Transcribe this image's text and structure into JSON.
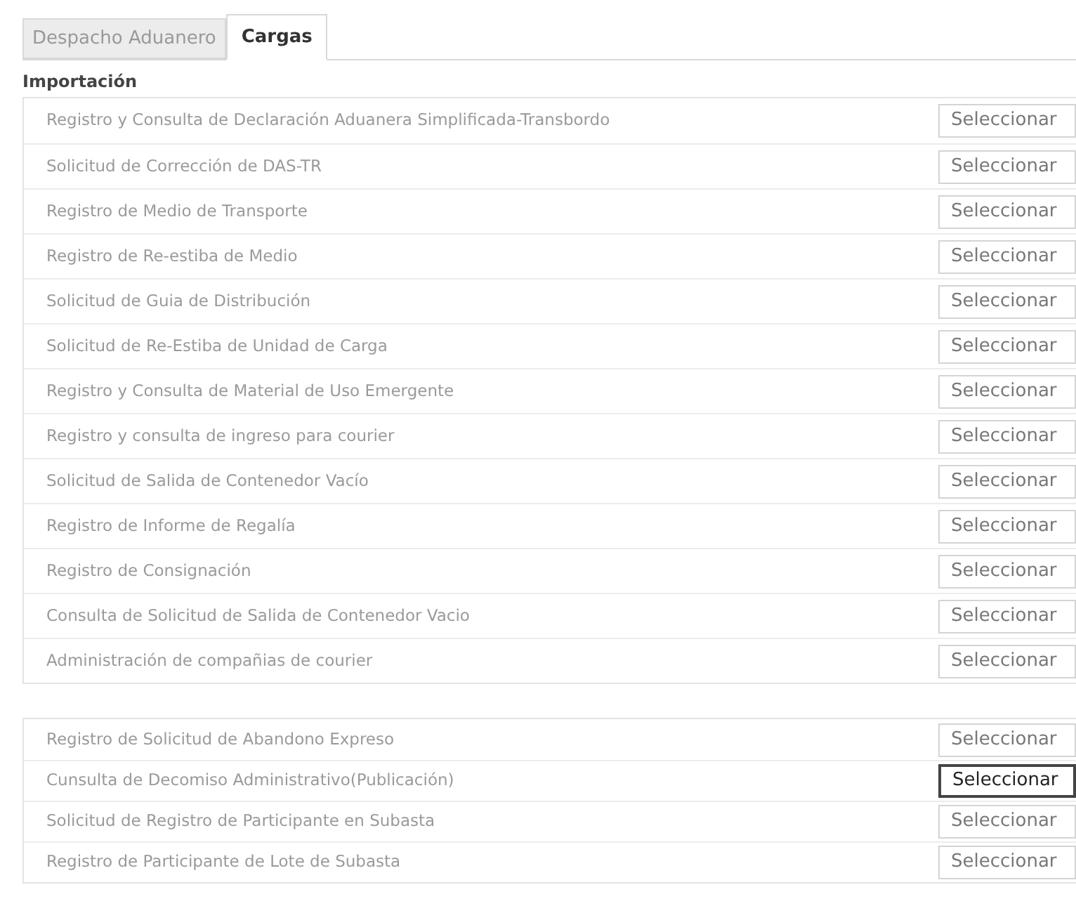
{
  "tabs": [
    {
      "label": "Despacho Aduanero",
      "selected": false
    },
    {
      "label": "Cargas",
      "selected": true
    }
  ],
  "section_title": "Importación",
  "groups": [
    {
      "items": [
        {
          "label": "Registro y Consulta de Declaración Aduanera Simplificada-Transbordo",
          "button": "Seleccionar",
          "focused": false
        },
        {
          "label": "Solicitud de Corrección de DAS-TR",
          "button": "Seleccionar",
          "focused": false
        },
        {
          "label": "Registro de Medio de Transporte",
          "button": "Seleccionar",
          "focused": false
        },
        {
          "label": "Registro de Re-estiba de Medio",
          "button": "Seleccionar",
          "focused": false
        },
        {
          "label": "Solicitud de Guia de Distribución",
          "button": "Seleccionar",
          "focused": false
        },
        {
          "label": "Solicitud de Re-Estiba de Unidad de Carga",
          "button": "Seleccionar",
          "focused": false
        },
        {
          "label": "Registro y Consulta de Material de Uso Emergente",
          "button": "Seleccionar",
          "focused": false
        },
        {
          "label": "Registro y consulta de ingreso para courier",
          "button": "Seleccionar",
          "focused": false
        },
        {
          "label": "Solicitud de Salida de Contenedor Vacío",
          "button": "Seleccionar",
          "focused": false
        },
        {
          "label": "Registro de Informe de Regalía",
          "button": "Seleccionar",
          "focused": false
        },
        {
          "label": "Registro de Consignación",
          "button": "Seleccionar",
          "focused": false
        },
        {
          "label": "Consulta de Solicitud de Salida de Contenedor Vacio",
          "button": "Seleccionar",
          "focused": false
        },
        {
          "label": "Administración de compañias de courier",
          "button": "Seleccionar",
          "focused": false
        }
      ]
    },
    {
      "items": [
        {
          "label": "Registro de Solicitud de Abandono Expreso",
          "button": "Seleccionar",
          "focused": false
        },
        {
          "label": "Cunsulta de Decomiso Administrativo(Publicación)",
          "button": "Seleccionar",
          "focused": true
        },
        {
          "label": "Solicitud de Registro de Participante en Subasta",
          "button": "Seleccionar",
          "focused": false
        },
        {
          "label": "Registro de Participante de Lote de Subasta",
          "button": "Seleccionar",
          "focused": false
        }
      ]
    }
  ]
}
